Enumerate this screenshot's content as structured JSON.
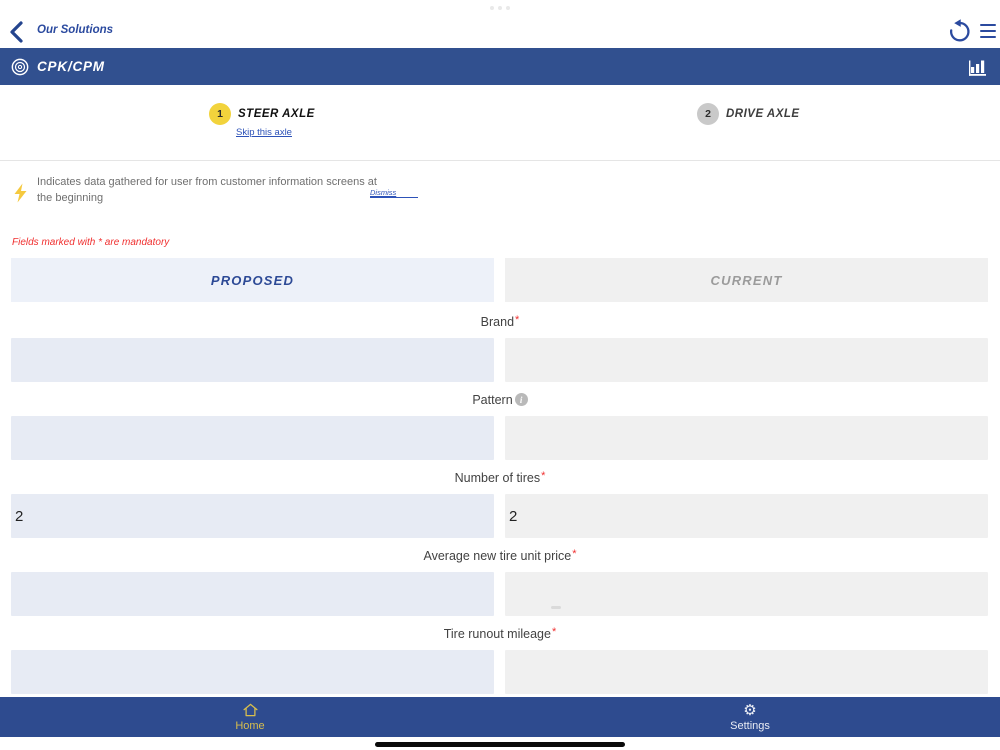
{
  "top_nav": {
    "back_label": "Our Solutions"
  },
  "app_bar": {
    "title": "CPK/CPM"
  },
  "stepper": {
    "steps": [
      {
        "number": "1",
        "label": "STEER AXLE",
        "skip_label": "Skip this axle"
      },
      {
        "number": "2",
        "label": "DRIVE AXLE"
      }
    ]
  },
  "info_banner": {
    "message": "Indicates data gathered for user from customer information screens at the beginning",
    "dismiss_label": "Dismiss"
  },
  "mandatory_note": "Fields marked with * are mandatory",
  "form": {
    "required_marker": "*",
    "info_glyph": "i",
    "column_headers": {
      "proposed": "PROPOSED",
      "current": "CURRENT"
    },
    "fields": [
      {
        "label": "Brand",
        "required": true,
        "info": false,
        "proposed_value": "",
        "current_value": ""
      },
      {
        "label": "Pattern",
        "required": false,
        "info": true,
        "proposed_value": "",
        "current_value": ""
      },
      {
        "label": "Number of tires",
        "required": true,
        "info": false,
        "proposed_value": "2",
        "current_value": "2"
      },
      {
        "label": "Average new tire unit price",
        "required": true,
        "info": false,
        "proposed_value": "",
        "current_value": ""
      },
      {
        "label": "Tire runout mileage",
        "required": true,
        "info": false,
        "proposed_value": "",
        "current_value": ""
      }
    ]
  },
  "bottom_nav": {
    "home_label": "Home",
    "settings_label": "Settings"
  },
  "colors": {
    "primary_blue": "#31508F",
    "link_blue": "#2B4A9F",
    "accent_yellow": "#F2D33C",
    "gold": "#D8BE4D",
    "error_red": "#F03030",
    "proposed_bg": "#EDF1F9",
    "current_bg": "#F0F0F0",
    "proposed_field_bg": "#E7EBF4"
  }
}
